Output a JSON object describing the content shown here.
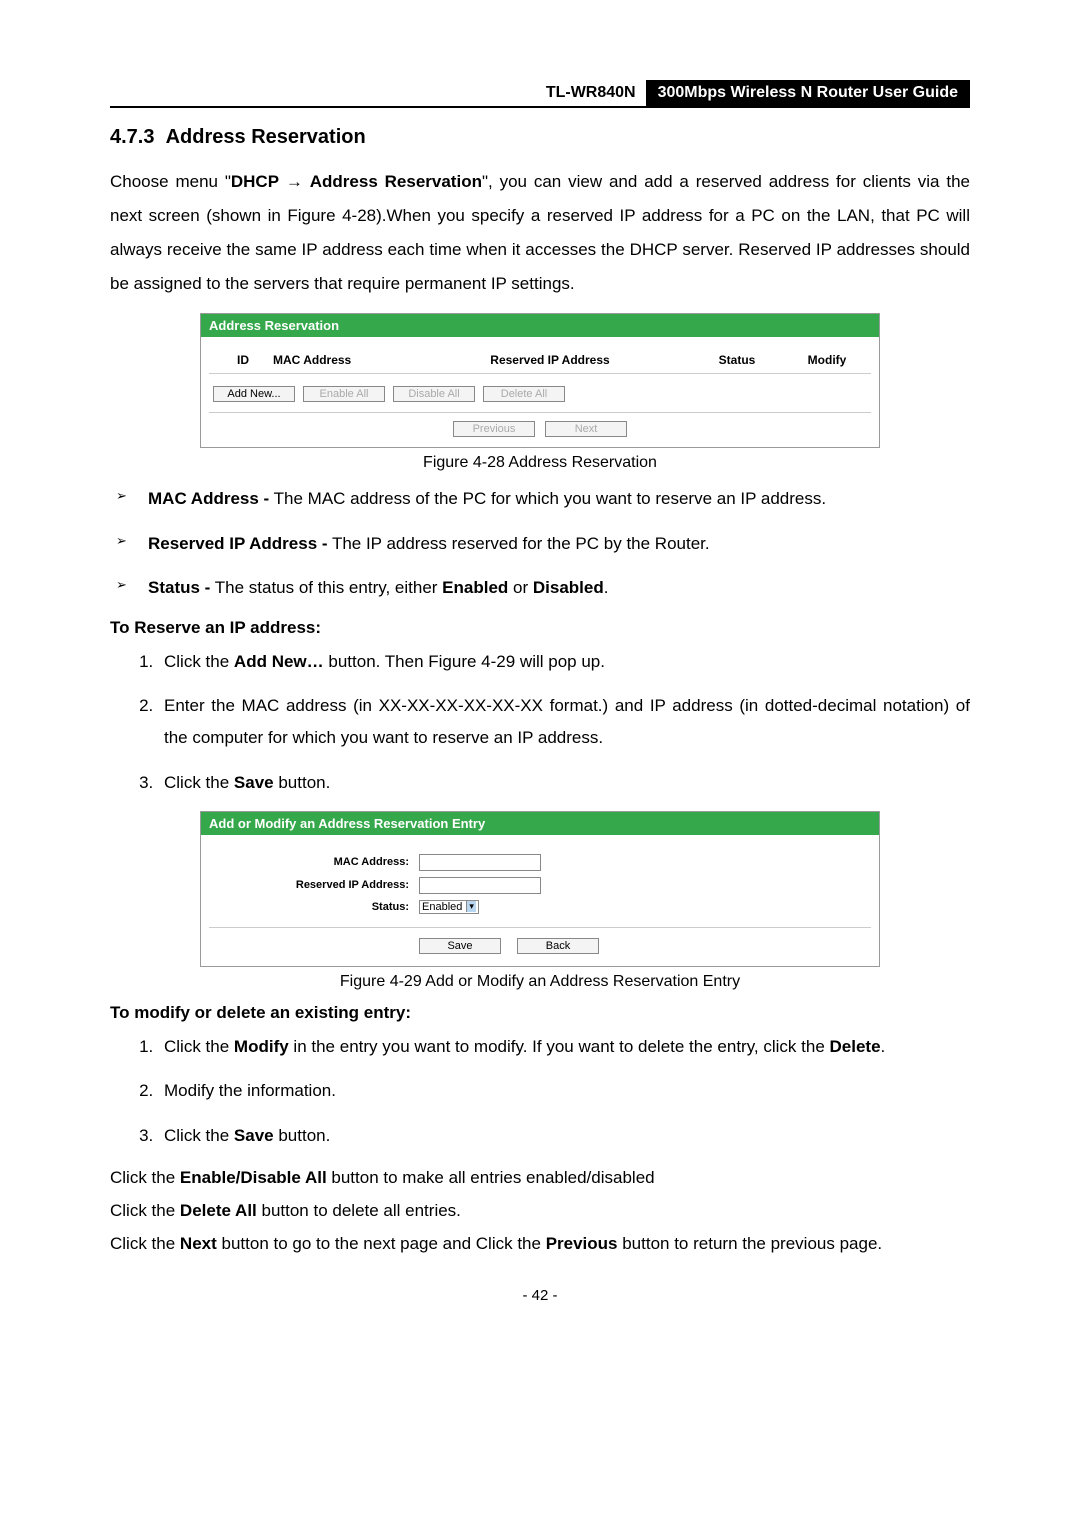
{
  "header": {
    "model": "TL-WR840N",
    "title": "300Mbps Wireless N Router User Guide"
  },
  "section_number": "4.7.3",
  "section_title": "Address Reservation",
  "intro_parts": {
    "p1": "Choose menu \"",
    "dhcp": "DHCP",
    "arrow": " → ",
    "addr_res": "Address Reservation",
    "p2": "\", you can view and add a reserved address for clients via the next screen (shown in Figure 4-28).When you specify a reserved IP address for a PC on the LAN, that PC will always receive the same IP address each time when it accesses the DHCP server. Reserved IP addresses should be assigned to the servers that require permanent IP settings."
  },
  "fig28": {
    "header": "Address Reservation",
    "cols": {
      "id": "ID",
      "mac": "MAC Address",
      "ip": "Reserved IP Address",
      "status": "Status",
      "modify": "Modify"
    },
    "buttons": {
      "add": "Add New...",
      "enable": "Enable All",
      "disable": "Disable All",
      "delete": "Delete All",
      "prev": "Previous",
      "next": "Next"
    },
    "caption": "Figure 4-28    Address Reservation"
  },
  "bullets": {
    "b1_label": "MAC Address -",
    "b1_text": " The MAC address of the PC for which you want to reserve an IP address.",
    "b2_label": "Reserved IP Address -",
    "b2_text": " The IP address reserved for the PC by the Router.",
    "b3_label": "Status -",
    "b3_text_a": " The status of this entry, either ",
    "b3_enabled": "Enabled",
    "b3_or": " or ",
    "b3_disabled": "Disabled",
    "b3_dot": "."
  },
  "reserve_heading": "To Reserve an IP address:",
  "reserve_steps": {
    "s1a": "Click the ",
    "s1b": "Add New…",
    "s1c": " button. Then Figure 4-29 will pop up.",
    "s2": "Enter the MAC address (in XX-XX-XX-XX-XX-XX format.) and IP address (in dotted-decimal notation) of the computer for which you want to reserve an IP address.",
    "s3a": "Click the ",
    "s3b": "Save",
    "s3c": " button."
  },
  "fig29": {
    "header": "Add or Modify an Address Reservation Entry",
    "labels": {
      "mac": "MAC Address:",
      "ip": "Reserved IP Address:",
      "status": "Status:"
    },
    "status_value": "Enabled",
    "buttons": {
      "save": "Save",
      "back": "Back"
    },
    "caption": "Figure 4-29    Add or Modify an Address Reservation Entry"
  },
  "modify_heading": "To modify or delete an existing entry:",
  "modify_steps": {
    "s1a": "Click the ",
    "s1b": "Modify",
    "s1c": " in the entry you want to modify. If you want to delete the entry, click the ",
    "s1d": "Delete",
    "s1e": ".",
    "s2": "Modify the information.",
    "s3a": "Click the ",
    "s3b": "Save",
    "s3c": " button."
  },
  "footer_lines": {
    "l1a": "Click the ",
    "l1b": "Enable/Disable All",
    "l1c": " button to make all entries enabled/disabled",
    "l2a": "Click the ",
    "l2b": "Delete All",
    "l2c": " button to delete all entries.",
    "l3a": "Click the ",
    "l3b": "Next",
    "l3c": " button to go to the next page and Click the ",
    "l3d": "Previous",
    "l3e": " button to return the previous page."
  },
  "page_number": "- 42 -"
}
